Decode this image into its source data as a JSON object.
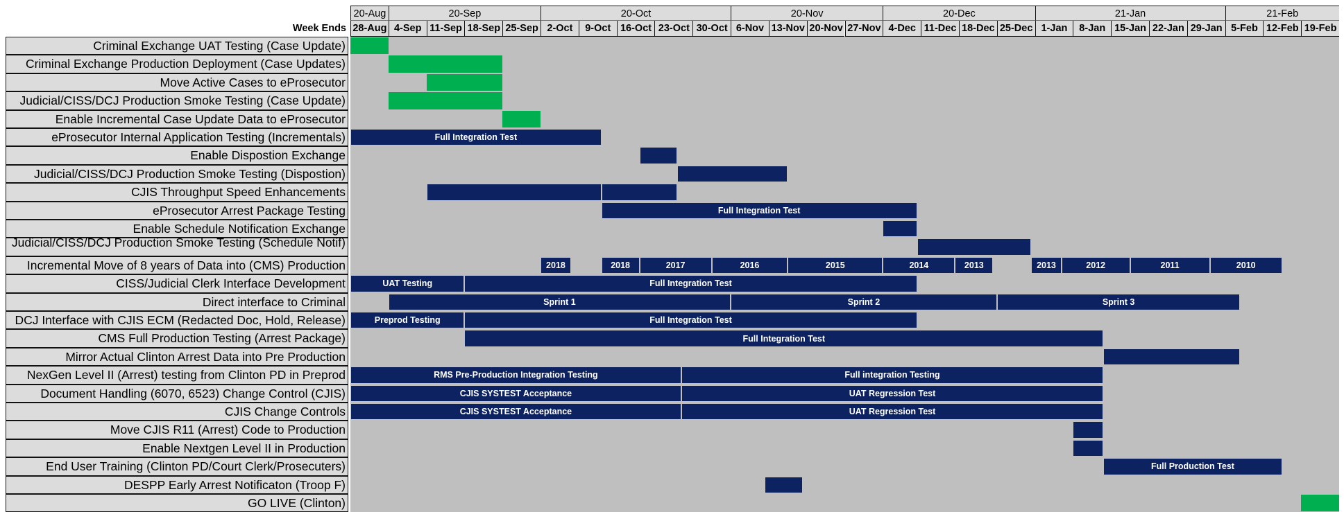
{
  "chart_data": {
    "type": "gantt",
    "week_ends_label": "Week Ends",
    "months": [
      {
        "label": "20-Aug",
        "start": 0,
        "span": 1
      },
      {
        "label": "20-Sep",
        "start": 1,
        "span": 4
      },
      {
        "label": "20-Oct",
        "start": 5,
        "span": 5
      },
      {
        "label": "20-Nov",
        "start": 10,
        "span": 4
      },
      {
        "label": "20-Dec",
        "start": 14,
        "span": 4
      },
      {
        "label": "21-Jan",
        "start": 18,
        "span": 5
      },
      {
        "label": "21-Feb",
        "start": 23,
        "span": 3
      }
    ],
    "weeks": [
      "28-Aug",
      "4-Sep",
      "11-Sep",
      "18-Sep",
      "25-Sep",
      "2-Oct",
      "9-Oct",
      "16-Oct",
      "23-Oct",
      "30-Oct",
      "6-Nov",
      "13-Nov",
      "20-Nov",
      "27-Nov",
      "4-Dec",
      "11-Dec",
      "18-Dec",
      "25-Dec",
      "1-Jan",
      "8-Jan",
      "15-Jan",
      "22-Jan",
      "29-Jan",
      "5-Feb",
      "12-Feb",
      "19-Feb"
    ],
    "colors": {
      "green": "#00b050",
      "navy": "#0d2260",
      "background": "#bfbfbf",
      "label_bg": "#dcdcdc"
    },
    "tasks": [
      {
        "label": "Criminal Exchange UAT Testing (Case Update)",
        "bars": [
          {
            "start": 0,
            "end": 1,
            "color": "green",
            "text": ""
          }
        ]
      },
      {
        "label": "Criminal Exchange Production Deployment (Case Updates)",
        "bars": [
          {
            "start": 1,
            "end": 4,
            "color": "green",
            "text": ""
          }
        ]
      },
      {
        "label": "Move Active Cases to eProsecutor",
        "bars": [
          {
            "start": 2,
            "end": 4,
            "color": "green",
            "text": ""
          }
        ]
      },
      {
        "label": "Judicial/CISS/DCJ Production Smoke Testing (Case Update)",
        "bars": [
          {
            "start": 1,
            "end": 4,
            "color": "green",
            "text": ""
          }
        ]
      },
      {
        "label": "Enable Incremental Case Update Data to eProsecutor",
        "bars": [
          {
            "start": 4,
            "end": 5,
            "color": "green",
            "text": ""
          }
        ]
      },
      {
        "label": "eProsecutor Internal Application Testing (Incrementals)",
        "bars": [
          {
            "start": 0,
            "end": 6.6,
            "color": "navy",
            "text": "Full Integration Test"
          }
        ]
      },
      {
        "label": "Enable Dispostion Exchange",
        "bars": [
          {
            "start": 7.6,
            "end": 8.6,
            "color": "navy",
            "text": ""
          }
        ]
      },
      {
        "label": "Judicial/CISS/DCJ Production Smoke Testing (Dispostion)",
        "bars": [
          {
            "start": 8.6,
            "end": 11.5,
            "color": "navy",
            "text": ""
          }
        ]
      },
      {
        "label": "CJIS Throughput Speed Enhancements",
        "bars": [
          {
            "start": 2,
            "end": 6.6,
            "color": "navy",
            "text": ""
          },
          {
            "start": 6.6,
            "end": 8.6,
            "color": "navy",
            "text": ""
          }
        ]
      },
      {
        "label": "eProsecutor Arrest Package Testing",
        "bars": [
          {
            "start": 6.6,
            "end": 14.9,
            "color": "navy",
            "text": "Full Integration Test"
          }
        ]
      },
      {
        "label": "Enable Schedule Notification Exchange",
        "bars": [
          {
            "start": 14,
            "end": 14.9,
            "color": "navy",
            "text": ""
          }
        ]
      },
      {
        "label": "Judicial/CISS/DCJ Production Smoke Testing (Schedule Notif)",
        "clipped": true,
        "bars": [
          {
            "start": 14.9,
            "end": 17.9,
            "color": "navy",
            "text": ""
          }
        ]
      },
      {
        "label": "Incremental Move of 8 years of Data into (CMS) Production",
        "bars": [
          {
            "start": 5,
            "end": 5.8,
            "color": "navy",
            "text": "2018"
          },
          {
            "start": 6.6,
            "end": 7.6,
            "color": "navy",
            "text": "2018"
          },
          {
            "start": 7.6,
            "end": 9.5,
            "color": "navy",
            "text": "2017"
          },
          {
            "start": 9.5,
            "end": 11.5,
            "color": "navy",
            "text": "2016"
          },
          {
            "start": 11.5,
            "end": 14,
            "color": "navy",
            "text": "2015"
          },
          {
            "start": 14,
            "end": 15.9,
            "color": "navy",
            "text": "2014"
          },
          {
            "start": 15.9,
            "end": 16.9,
            "color": "navy",
            "text": "2013"
          },
          {
            "start": 17.9,
            "end": 18.7,
            "color": "navy",
            "text": "2013"
          },
          {
            "start": 18.7,
            "end": 20.5,
            "color": "navy",
            "text": "2012"
          },
          {
            "start": 20.5,
            "end": 22.6,
            "color": "navy",
            "text": "2011"
          },
          {
            "start": 22.6,
            "end": 24.5,
            "color": "navy",
            "text": "2010"
          }
        ]
      },
      {
        "label": "CISS/Judicial Clerk Interface Development",
        "bars": [
          {
            "start": 0,
            "end": 3,
            "color": "navy",
            "text": "UAT Testing"
          },
          {
            "start": 3,
            "end": 14.9,
            "color": "navy",
            "text": "Full Integration Test"
          }
        ]
      },
      {
        "label": "Direct interface to Criminal",
        "bars": [
          {
            "start": 1,
            "end": 10,
            "color": "navy",
            "text": "Sprint 1"
          },
          {
            "start": 10,
            "end": 17,
            "color": "navy",
            "text": "Sprint 2"
          },
          {
            "start": 17,
            "end": 23.4,
            "color": "navy",
            "text": "Sprint 3"
          }
        ]
      },
      {
        "label": "DCJ Interface with CJIS ECM (Redacted Doc, Hold, Release)",
        "bars": [
          {
            "start": 0,
            "end": 3,
            "color": "navy",
            "text": "Preprod Testing"
          },
          {
            "start": 3,
            "end": 14.9,
            "color": "navy",
            "text": "Full Integration Test"
          }
        ]
      },
      {
        "label": "CMS Full Production Testing (Arrest Package)",
        "bars": [
          {
            "start": 3,
            "end": 19.8,
            "color": "navy",
            "text": "Full Integration Test"
          }
        ]
      },
      {
        "label": "Mirror Actual Clinton Arrest Data into Pre Production",
        "bars": [
          {
            "start": 19.8,
            "end": 23.4,
            "color": "navy",
            "text": ""
          }
        ]
      },
      {
        "label": "NexGen Level II (Arrest) testing from Clinton PD in Preprod",
        "bars": [
          {
            "start": 0,
            "end": 8.7,
            "color": "navy",
            "text": "RMS Pre-Production Integration Testing"
          },
          {
            "start": 8.7,
            "end": 19.8,
            "color": "navy",
            "text": "Full integration Testing"
          }
        ]
      },
      {
        "label": "Document Handling (6070, 6523) Change Control (CJIS)",
        "bars": [
          {
            "start": 0,
            "end": 8.7,
            "color": "navy",
            "text": "CJIS SYSTEST Acceptance"
          },
          {
            "start": 8.7,
            "end": 19.8,
            "color": "navy",
            "text": "UAT Regression Test"
          }
        ]
      },
      {
        "label": "CJIS Change Controls",
        "bars": [
          {
            "start": 0,
            "end": 8.7,
            "color": "navy",
            "text": "CJIS SYSTEST Acceptance"
          },
          {
            "start": 8.7,
            "end": 19.8,
            "color": "navy",
            "text": "UAT Regression Test"
          }
        ]
      },
      {
        "label": "Move CJIS R11 (Arrest) Code to Production",
        "bars": [
          {
            "start": 19,
            "end": 19.8,
            "color": "navy",
            "text": ""
          }
        ]
      },
      {
        "label": "Enable Nextgen Level II in Production",
        "bars": [
          {
            "start": 19,
            "end": 19.8,
            "color": "navy",
            "text": ""
          }
        ]
      },
      {
        "label": "End User Training (Clinton PD/Court Clerk/Prosecuters)",
        "bars": [
          {
            "start": 19.8,
            "end": 24.5,
            "color": "navy",
            "text": "Full Production Test"
          }
        ]
      },
      {
        "label": "DESPP Early Arrest Notificaton (Troop F)",
        "bars": [
          {
            "start": 10.9,
            "end": 11.9,
            "color": "navy",
            "text": ""
          }
        ]
      },
      {
        "label": "GO LIVE (Clinton)",
        "bars": [
          {
            "start": 25,
            "end": 26,
            "color": "green",
            "text": ""
          }
        ]
      }
    ]
  }
}
